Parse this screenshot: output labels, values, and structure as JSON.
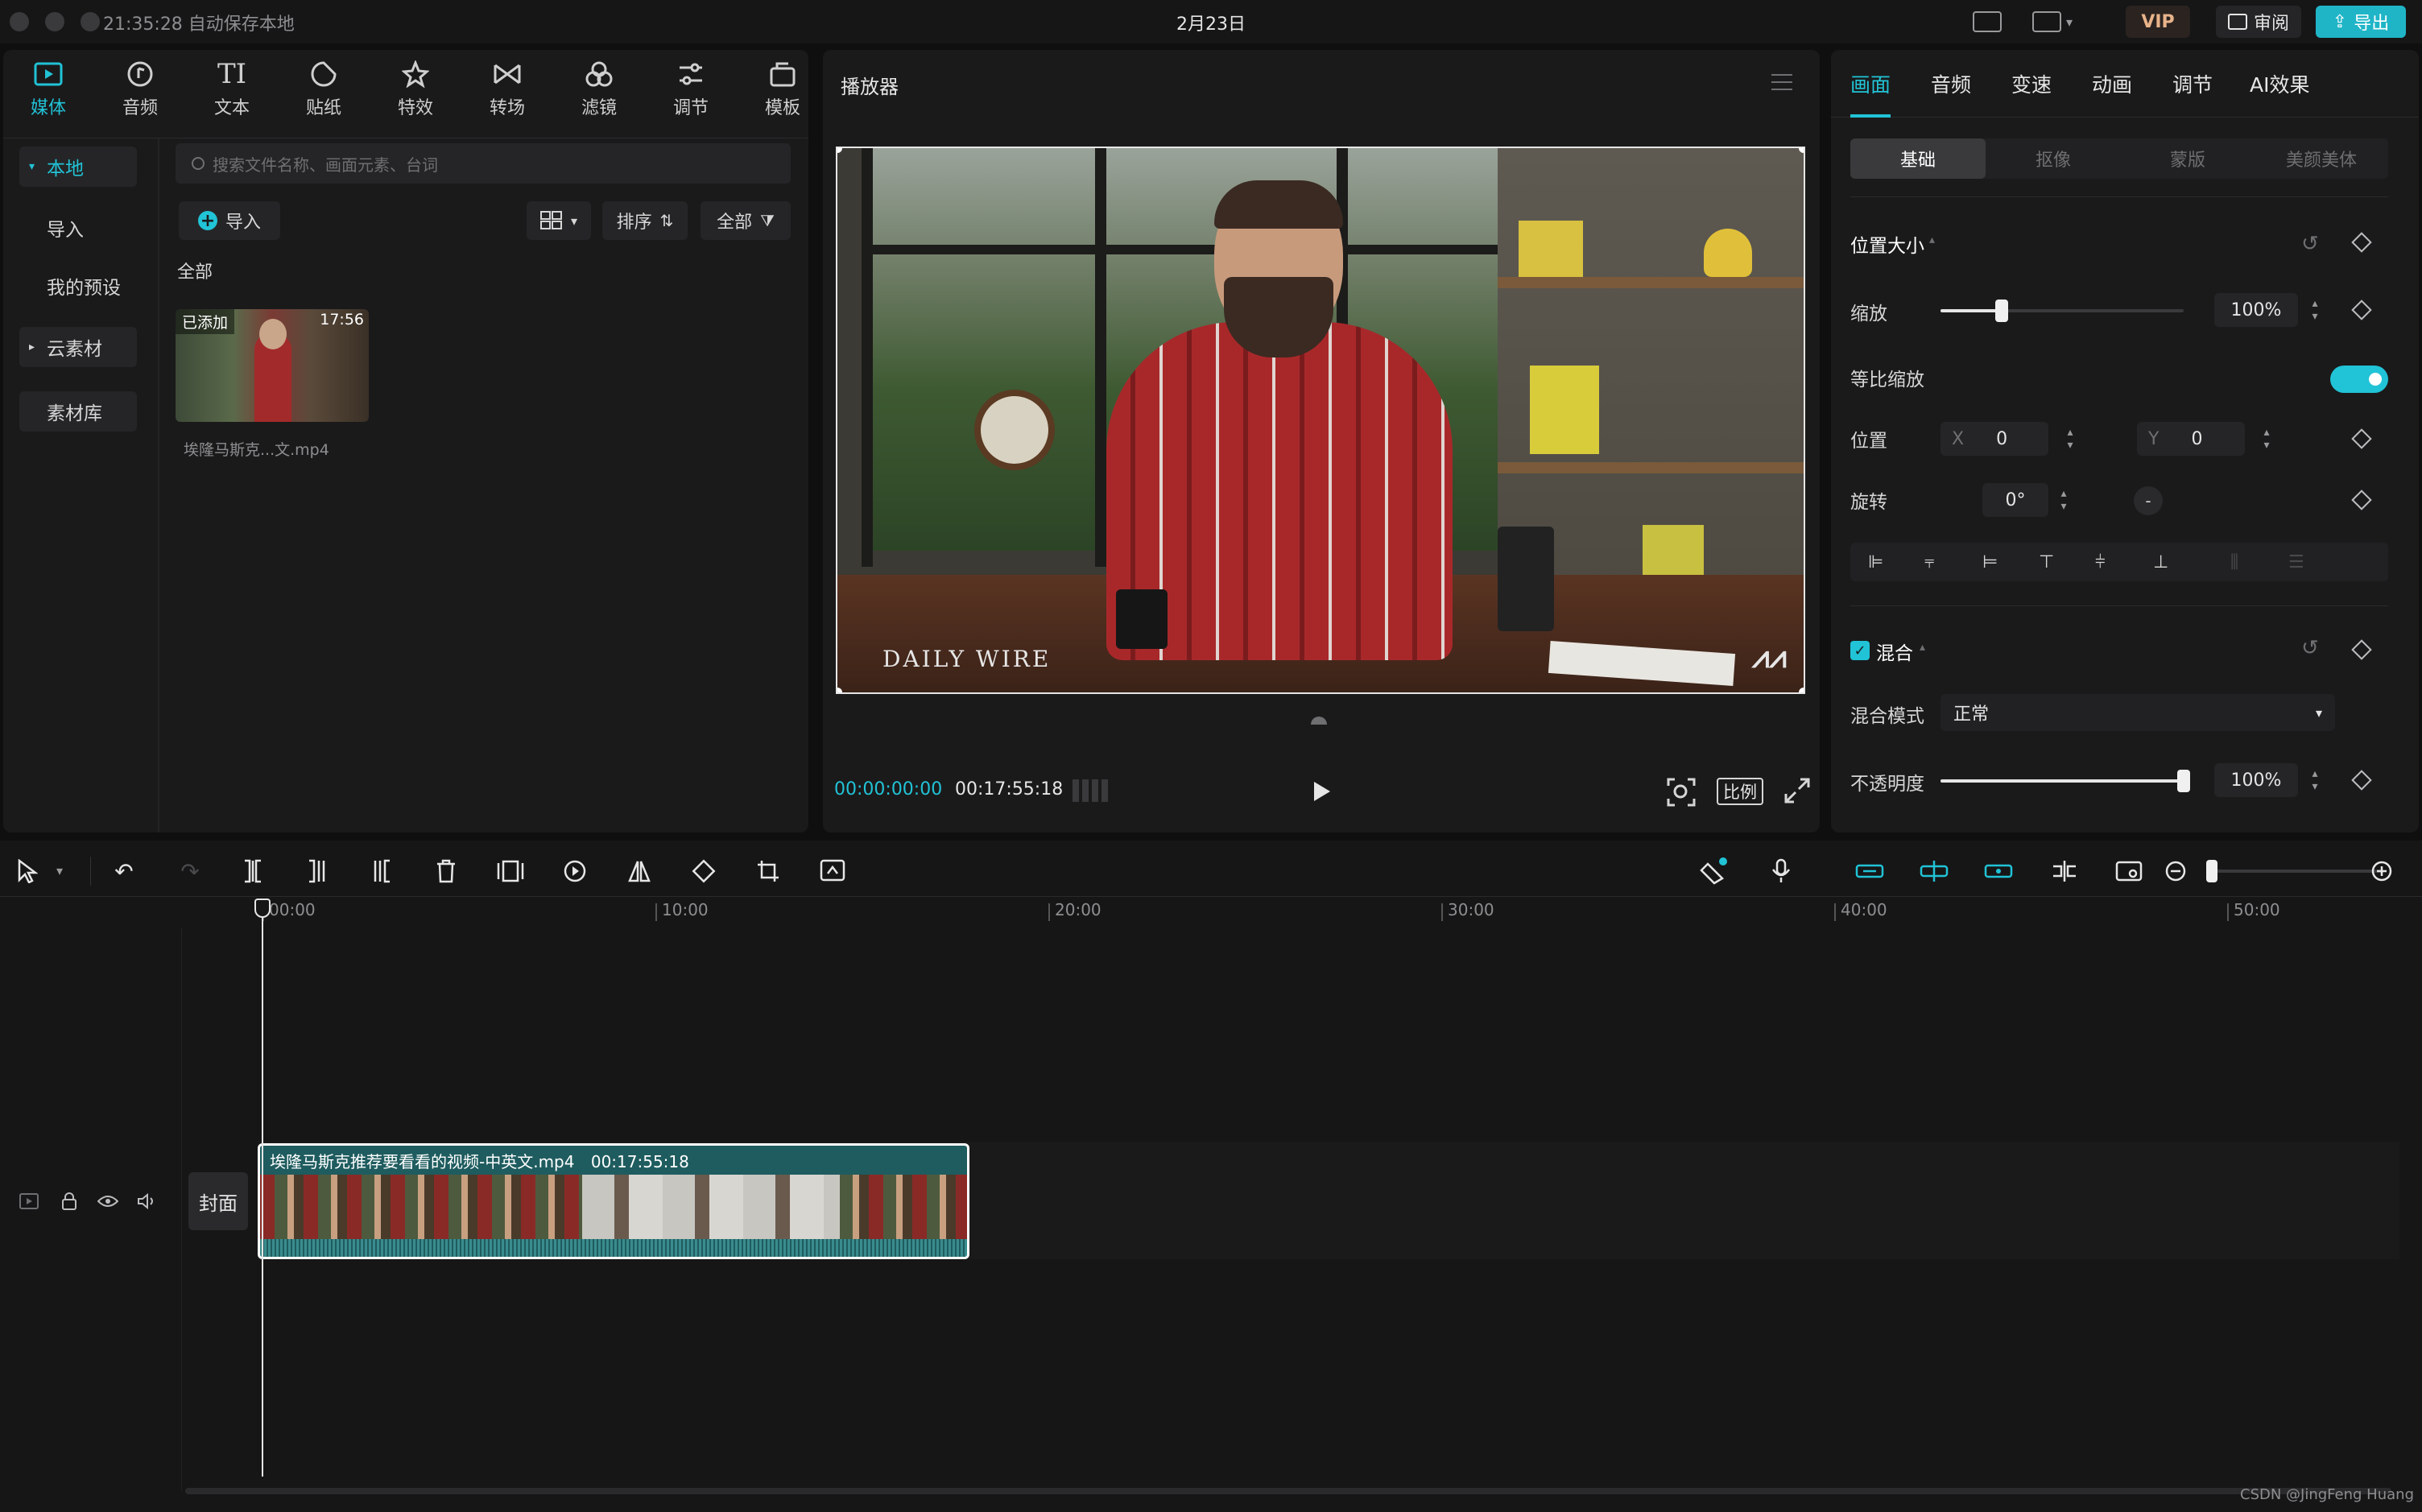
{
  "titlebar": {
    "status": "21:35:28 自动保存本地",
    "date": "2月23日",
    "vip": "VIP",
    "review": "审阅",
    "export": "导出"
  },
  "media_tabs": [
    {
      "label": "媒体",
      "icon": "media-icon"
    },
    {
      "label": "音频",
      "icon": "audio-icon"
    },
    {
      "label": "文本",
      "icon": "text-icon"
    },
    {
      "label": "贴纸",
      "icon": "sticker-icon"
    },
    {
      "label": "特效",
      "icon": "effects-icon"
    },
    {
      "label": "转场",
      "icon": "transition-icon"
    },
    {
      "label": "滤镜",
      "icon": "filter-icon"
    },
    {
      "label": "调节",
      "icon": "adjust-icon"
    },
    {
      "label": "模板",
      "icon": "template-icon"
    }
  ],
  "sidebar": {
    "local": "本地",
    "import": "导入",
    "presets": "我的预设",
    "cloud": "云素材",
    "library": "素材库"
  },
  "media_panel": {
    "search_placeholder": "搜索文件名称、画面元素、台词",
    "import_button": "导入",
    "sort": "排序",
    "filter": "全部",
    "section": "全部",
    "clip": {
      "badge": "已添加",
      "duration": "17:56",
      "filename": "埃隆马斯克...文.mp4"
    }
  },
  "player": {
    "title": "播放器",
    "watermark": "DAILY WIRE",
    "current_time": "00:00:00:00",
    "total_time": "00:17:55:18",
    "ratio": "比例"
  },
  "inspector": {
    "tabs": [
      "画面",
      "音频",
      "变速",
      "动画",
      "调节",
      "AI效果"
    ],
    "subtabs": [
      "基础",
      "抠像",
      "蒙版",
      "美颜美体"
    ],
    "section_position": "位置大小",
    "scale_label": "缩放",
    "scale_value": "100%",
    "scale_level": 0.25,
    "uniform_label": "等比缩放",
    "position_label": "位置",
    "x_label": "X",
    "x_value": "0",
    "y_label": "Y",
    "y_value": "0",
    "rotate_label": "旋转",
    "rotate_value": "0°",
    "section_blend": "混合",
    "blend_mode_label": "混合模式",
    "blend_mode_value": "正常",
    "opacity_label": "不透明度",
    "opacity_value": "100%",
    "opacity_level": 1.0
  },
  "timeline": {
    "ruler": [
      "00:00",
      "10:00",
      "20:00",
      "30:00",
      "40:00",
      "50:00"
    ],
    "cover": "封面",
    "clip_name": "埃隆马斯克推荐要看看的视频-中英文.mp4",
    "clip_duration": "00:17:55:18"
  },
  "footer": {
    "watermark": "CSDN @JingFeng Huang"
  },
  "colors": {
    "accent": "#21c3d6",
    "clip_bg": "#1f5c5f",
    "vip_text": "#e8b38a"
  }
}
